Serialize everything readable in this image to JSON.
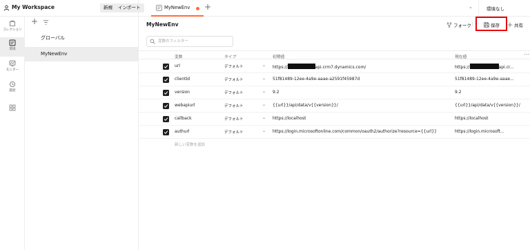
{
  "workspace": {
    "title": "My Workspace",
    "new_label": "新規",
    "import_label": "インポート"
  },
  "tabs": [
    {
      "label": "MyNewEnv",
      "unsaved": true
    }
  ],
  "environment_selector": {
    "selected": "環境なし"
  },
  "rail": [
    {
      "label": "コレクション",
      "icon": "collections-icon"
    },
    {
      "label": "環境",
      "icon": "environments-icon",
      "active": true
    },
    {
      "label": "モニター",
      "icon": "monitor-icon"
    },
    {
      "label": "履歴",
      "icon": "history-icon"
    },
    {
      "label": "",
      "icon": "apps-icon"
    }
  ],
  "env_list": {
    "global_label": "グローバル",
    "items": [
      "MyNewEnv"
    ]
  },
  "main": {
    "title": "MyNewEnv",
    "actions": {
      "fork": "フォーク",
      "save": "保存",
      "share": "共有"
    },
    "filter_placeholder": "変数のフィルター",
    "columns": {
      "variable": "変数",
      "type": "タイプ",
      "initial": "初期値",
      "current": "現在値"
    },
    "rows": [
      {
        "enabled": true,
        "variable": "url",
        "type": "デフォルト",
        "initial_suffix": "api.crm7.dynamics.com/",
        "current_suffix": "api.cr..."
      },
      {
        "enabled": true,
        "variable": "clientId",
        "type": "デフォルト",
        "initial": "51f81489-12ee-4a9e-aaae-a2591f45987d",
        "current": "51f81489-12ee-4a9e-aaae..."
      },
      {
        "enabled": true,
        "variable": "version",
        "type": "デフォルト",
        "initial": "9.2",
        "current": "9.2"
      },
      {
        "enabled": true,
        "variable": "webapiurl",
        "type": "デフォルト",
        "initial": "{{url}}/api/data/v{{version}}/",
        "current": "{{url}}/api/data/v{{version}}/"
      },
      {
        "enabled": true,
        "variable": "callback",
        "type": "デフォルト",
        "initial": "https://localhost",
        "current": "https://localhost"
      },
      {
        "enabled": true,
        "variable": "authurl",
        "type": "デフォルト",
        "initial": "https://login.microsoftonline.com/common/oauth2/authorize?resource={{url}}",
        "current": "https://login.microsoft..."
      }
    ],
    "url_prefix": "https://",
    "add_variable_placeholder": "新しい変数を追加"
  },
  "colors": {
    "accent": "#ff6c37",
    "highlight": "#e8000b",
    "checkbox": "#1f1f1f",
    "selected_bg": "#ededed"
  }
}
